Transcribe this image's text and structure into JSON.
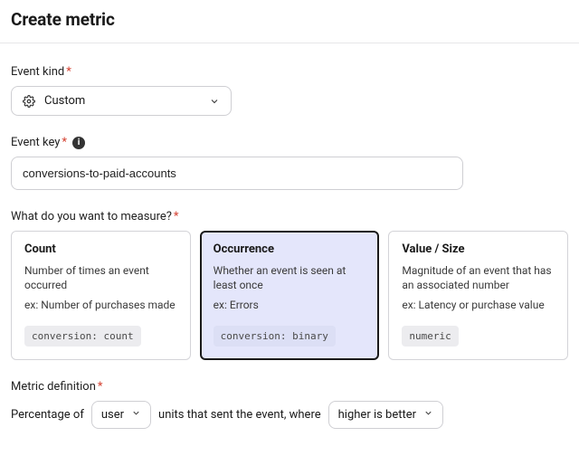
{
  "title": "Create metric",
  "eventKind": {
    "label": "Event kind",
    "value": "Custom"
  },
  "eventKey": {
    "label": "Event key",
    "value": "conversions-to-paid-accounts"
  },
  "measure": {
    "label": "What do you want to measure?",
    "options": [
      {
        "title": "Count",
        "desc": "Number of times an event occurred",
        "ex": "ex: Number of purchases made",
        "tag": "conversion: count",
        "selected": false
      },
      {
        "title": "Occurrence",
        "desc": "Whether an event is seen at least once",
        "ex": "ex: Errors",
        "tag": "conversion: binary",
        "selected": true
      },
      {
        "title": "Value / Size",
        "desc": "Magnitude of an event that has an associated number",
        "ex": "ex: Latency or purchase value",
        "tag": "numeric",
        "selected": false
      }
    ]
  },
  "definition": {
    "label": "Metric definition",
    "prefix": "Percentage of",
    "unitValue": "user",
    "middle": "units that sent the event, where",
    "directionValue": "higher is better"
  }
}
